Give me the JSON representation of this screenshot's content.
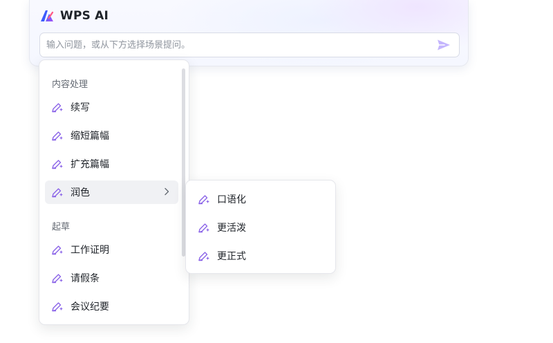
{
  "header": {
    "brand_name": "WPS AI",
    "logo_icon": "wps-ai-logo-icon",
    "brand_color": "#3b5bfd",
    "accent_color": "#8b5cf6"
  },
  "ask": {
    "placeholder": "输入问题，或从下方选择场景提问。",
    "send_icon": "send-icon"
  },
  "menu": {
    "groups": [
      {
        "label": "内容处理",
        "items": [
          {
            "label": "续写",
            "icon": "ai-pen-sparkle-icon"
          },
          {
            "label": "缩短篇幅",
            "icon": "ai-pen-sparkle-icon"
          },
          {
            "label": "扩充篇幅",
            "icon": "ai-pen-sparkle-icon"
          },
          {
            "label": "润色",
            "icon": "ai-pen-sparkle-icon",
            "has_submenu": true
          }
        ]
      },
      {
        "label": "起草",
        "items": [
          {
            "label": "工作证明",
            "icon": "ai-pen-sparkle-icon"
          },
          {
            "label": "请假条",
            "icon": "ai-pen-sparkle-icon"
          },
          {
            "label": "会议纪要",
            "icon": "ai-pen-sparkle-icon"
          }
        ]
      }
    ]
  },
  "submenu": {
    "items": [
      {
        "label": "口语化",
        "icon": "ai-pen-sparkle-icon"
      },
      {
        "label": "更活泼",
        "icon": "ai-pen-sparkle-icon"
      },
      {
        "label": "更正式",
        "icon": "ai-pen-sparkle-icon"
      }
    ]
  }
}
